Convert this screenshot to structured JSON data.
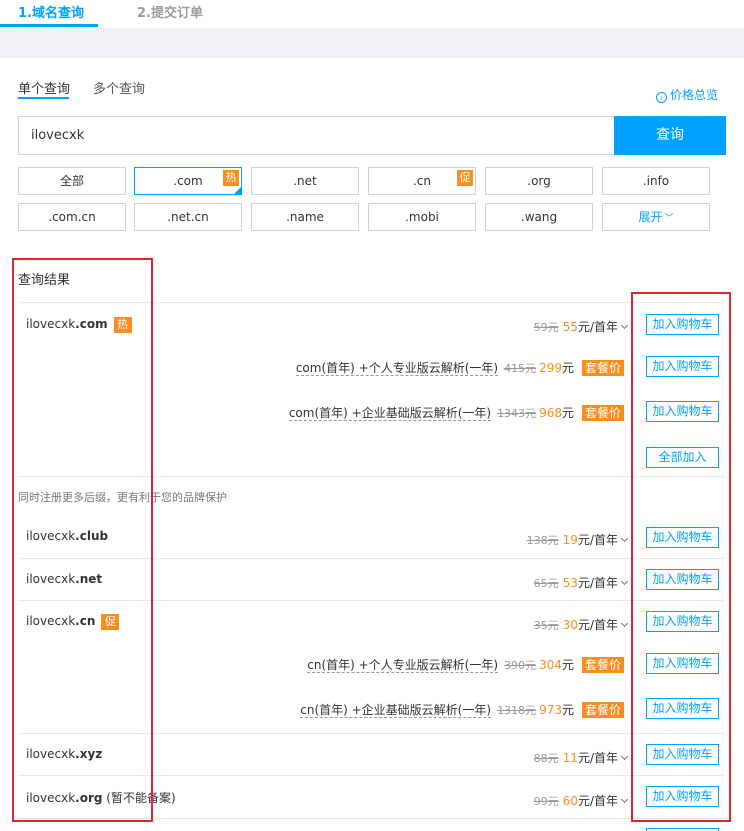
{
  "steps": {
    "step1": "1.域名查询",
    "step2": "2.提交订单"
  },
  "query_tabs": {
    "single": "单个查询",
    "multi": "多个查询"
  },
  "price_overview": {
    "icon": "circle-arrow-icon",
    "label": "价格总览"
  },
  "search": {
    "value": "ilovecxk",
    "button": "查询"
  },
  "tlds": [
    {
      "label": "全部",
      "selected": false,
      "tag": ""
    },
    {
      "label": ".com",
      "selected": true,
      "tag": "热"
    },
    {
      "label": ".net",
      "selected": false,
      "tag": ""
    },
    {
      "label": ".cn",
      "selected": false,
      "tag": "促"
    },
    {
      "label": ".org",
      "selected": false,
      "tag": ""
    },
    {
      "label": ".info",
      "selected": false,
      "tag": ""
    },
    {
      "label": ".com.cn",
      "selected": false,
      "tag": ""
    },
    {
      "label": ".net.cn",
      "selected": false,
      "tag": ""
    },
    {
      "label": ".name",
      "selected": false,
      "tag": ""
    },
    {
      "label": ".mobi",
      "selected": false,
      "tag": ""
    },
    {
      "label": ".wang",
      "selected": false,
      "tag": ""
    },
    {
      "label": "展开",
      "selected": false,
      "tag": ""
    }
  ],
  "results": {
    "title": "查询结果",
    "primary": {
      "name": "ilovecxk",
      "ext": ".com",
      "badge": "热",
      "old_price": "59元",
      "new_price": "55",
      "unit": "元/首年",
      "bundles": [
        {
          "desc": "com(首年) +个人专业版云解析(一年)",
          "old_price": "415元",
          "new_price": "299",
          "unit": "元",
          "tag": "套餐价"
        },
        {
          "desc": "com(首年) +企业基础版云解析(一年)",
          "old_price": "1343元",
          "new_price": "968",
          "unit": "元",
          "tag": "套餐价"
        }
      ],
      "add_all": "全部加入"
    },
    "note": "同时注册更多后缀，更有利于您的品牌保护",
    "others": [
      {
        "name": "ilovecxk",
        "ext": ".club",
        "badge": "",
        "suffix": "",
        "old_price": "138元",
        "new_price": "19",
        "unit": "元/首年"
      },
      {
        "name": "ilovecxk",
        "ext": ".net",
        "badge": "",
        "suffix": "",
        "old_price": "65元",
        "new_price": "53",
        "unit": "元/首年"
      },
      {
        "name": "ilovecxk",
        "ext": ".cn",
        "badge": "促",
        "suffix": "",
        "old_price": "35元",
        "new_price": "30",
        "unit": "元/首年"
      },
      {
        "name": "ilovecxk",
        "ext": ".xyz",
        "badge": "",
        "suffix": "",
        "old_price": "88元",
        "new_price": "11",
        "unit": "元/首年"
      },
      {
        "name": "ilovecxk",
        "ext": ".org",
        "badge": "",
        "suffix": " (暂不能备案)",
        "old_price": "99元",
        "new_price": "60",
        "unit": "元/首年"
      }
    ],
    "cn_bundles": [
      {
        "desc": "cn(首年) +个人专业版云解析(一年)",
        "old_price": "390元",
        "new_price": "304",
        "unit": "元",
        "tag": "套餐价"
      },
      {
        "desc": "cn(首年) +企业基础版云解析(一年)",
        "old_price": "1318元",
        "new_price": "973",
        "unit": "元",
        "tag": "套餐价"
      }
    ],
    "cart_label": "加入购物车"
  },
  "colors": {
    "accent": "#00a2ff",
    "orange": "#f98d1f",
    "highlight_box": "#e0262c"
  }
}
